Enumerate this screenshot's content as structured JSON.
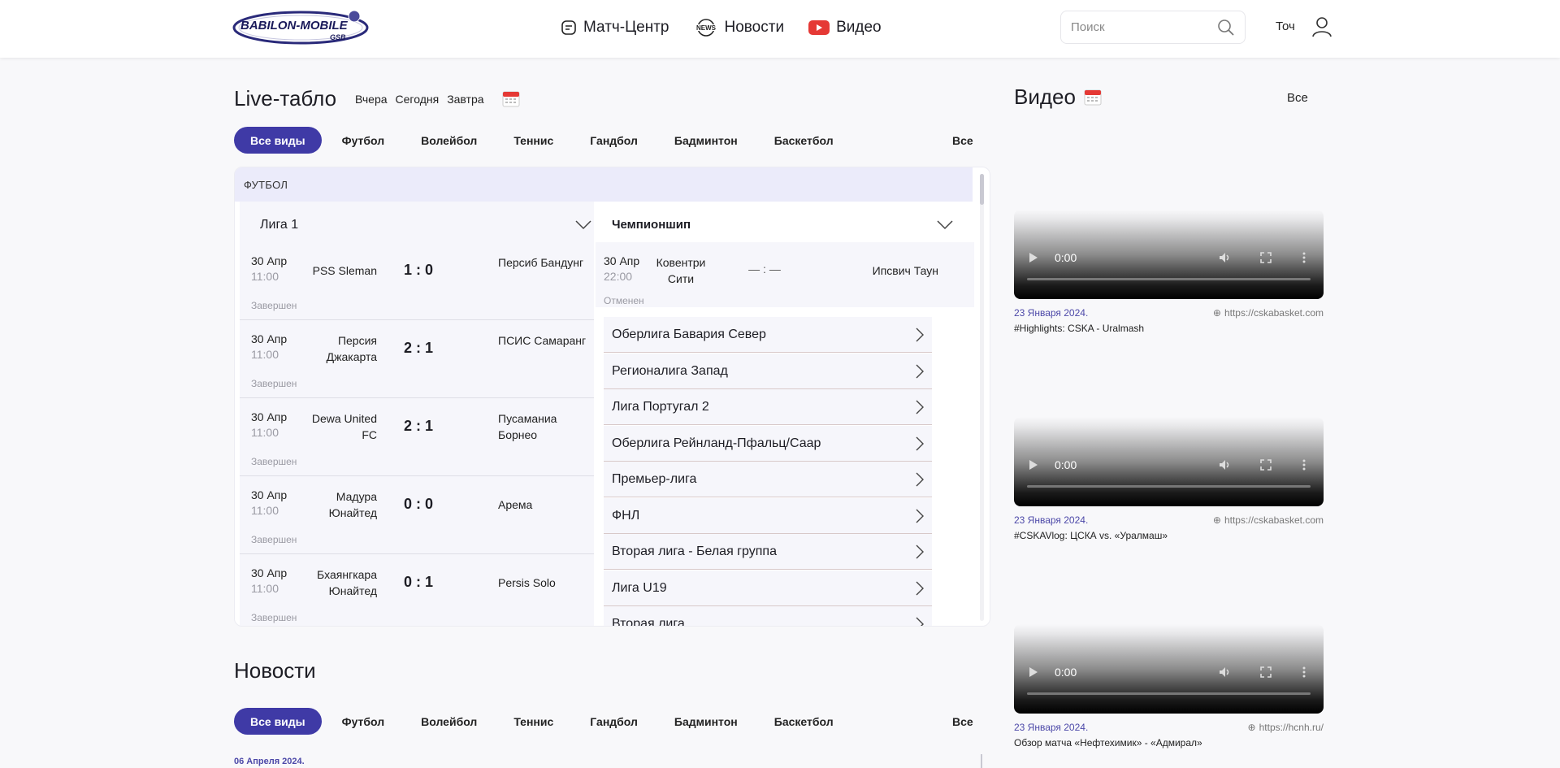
{
  "header": {
    "logo_text": "BABILON-MOBILE",
    "logo_sub": "GSB",
    "nav": [
      {
        "label": "Матч-Центр",
        "icon": "match-center-icon"
      },
      {
        "label": "Новости",
        "icon": "news-icon"
      },
      {
        "label": "Видео",
        "icon": "video-play-icon"
      }
    ],
    "search_placeholder": "Поиск",
    "user_label": "Точ"
  },
  "live": {
    "title": "Live-табло",
    "days": [
      "Вчера",
      "Сегодня",
      "Завтра"
    ],
    "tabs": [
      "Все виды",
      "Футбол",
      "Волейбол",
      "Теннис",
      "Гандбол",
      "Бадминтон",
      "Баскетбол"
    ],
    "tabs_all": "Все",
    "sport": "ФУТБОЛ",
    "left_league": "Лига 1",
    "left_matches": [
      {
        "date": "30 Апр",
        "time": "11:00",
        "home": "PSS Sleman",
        "score": "1 : 0",
        "away": "Персиб Бандунг",
        "status": "Завершен"
      },
      {
        "date": "30 Апр",
        "time": "11:00",
        "home": "Персия Джакарта",
        "score": "2 : 1",
        "away": "ПСИС Самаранг",
        "status": "Завершен"
      },
      {
        "date": "30 Апр",
        "time": "11:00",
        "home": "Dewa United FC",
        "score": "2 : 1",
        "away": "Пусаманиа Борнео",
        "status": "Завершен"
      },
      {
        "date": "30 Апр",
        "time": "11:00",
        "home": "Мадура Юнайтед",
        "score": "0 : 0",
        "away": "Арема",
        "status": "Завершен"
      },
      {
        "date": "30 Апр",
        "time": "11:00",
        "home": "Бхаянгкара Юнайтед",
        "score": "0 : 1",
        "away": "Persis Solo",
        "status": "Завершен"
      }
    ],
    "right_league": "Чемпионшип",
    "right_match": {
      "date": "30 Апр",
      "time": "22:00",
      "home": "Ковентри Сити",
      "score": "— : —",
      "away": "Ипсвич Таун",
      "status": "Отменен"
    },
    "leagues": [
      "Оберлига Бавария Север",
      "Регионалига Запад",
      "Лига Португал 2",
      "Оберлига Рейнланд-Пфальц/Саар",
      "Премьер-лига",
      "ФНЛ",
      "Вторая лига - Белая группа",
      "Лига U19",
      "Вторая лига"
    ]
  },
  "video": {
    "title": "Видео",
    "all": "Все",
    "items": [
      {
        "time": "0:00",
        "date": "23 Января 2024.",
        "source": "https://cskabasket.com",
        "caption": "#Highlights: CSKA - Uralmash"
      },
      {
        "time": "0:00",
        "date": "23 Января 2024.",
        "source": "https://cskabasket.com",
        "caption": "#CSKAVlog: ЦСКА vs. «Уралмаш»"
      },
      {
        "time": "0:00",
        "date": "23 Января 2024.",
        "source": "https://hcnh.ru/",
        "caption": "Обзор матча «Нефтехимик» - «Адмирал»"
      }
    ]
  },
  "news": {
    "title": "Новости",
    "tabs": [
      "Все виды",
      "Футбол",
      "Волейбол",
      "Теннис",
      "Гандбол",
      "Бадминтон",
      "Баскетбол"
    ],
    "tabs_all": "Все",
    "first_date": "06 Апреля 2024."
  },
  "colors": {
    "accent": "#3f3aa6",
    "sport_bar": "#ebebfa",
    "date_link": "#4c48a8",
    "youtube_red": "#e53935"
  }
}
